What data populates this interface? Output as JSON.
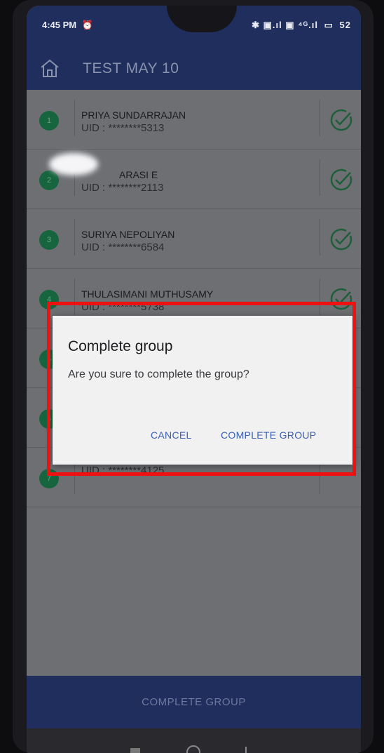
{
  "status_bar": {
    "time": "4:45 PM",
    "alarm_icon": "alarm-clock-icon",
    "icons": "✱ ▣.ıl ▣ ⁴ᴳ.ıl",
    "battery": "52"
  },
  "app_bar": {
    "title": "TEST MAY 10",
    "home_icon": "home-icon"
  },
  "list": {
    "rows": [
      {
        "number": "1",
        "name": "PRIYA SUNDARRAJAN",
        "uid": "UID : ********5313"
      },
      {
        "number": "2",
        "name": "ARASI E",
        "uid": "UID : ********2113"
      },
      {
        "number": "3",
        "name": "SURIYA NEPOLIYAN",
        "uid": "UID : ********6584"
      },
      {
        "number": "4",
        "name": "THULASIMANI MUTHUSAMY",
        "uid": "UID : ********5738"
      },
      {
        "number": "5",
        "name": "",
        "uid": ""
      },
      {
        "number": "6",
        "name": "",
        "uid": ""
      },
      {
        "number": "7",
        "name": "",
        "uid": "UID : ********4125"
      }
    ]
  },
  "dialog": {
    "title": "Complete group",
    "message": "Are you sure to complete the group?",
    "cancel_label": "CANCEL",
    "confirm_label": "COMPLETE GROUP"
  },
  "bottom_button": {
    "label": "COMPLETE GROUP"
  },
  "colors": {
    "app_bar": "#1f2e5c",
    "accent_green": "#17653f",
    "dialog_button": "#3a5fb4",
    "highlight": "#ee1111"
  }
}
